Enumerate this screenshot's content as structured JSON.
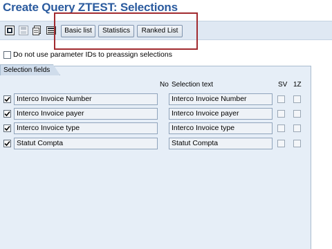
{
  "window": {
    "title": "Create Query ZTEST: Selections"
  },
  "toolbar": {
    "icons": [
      "execute-icon",
      "save-icon",
      "get-variant-icon",
      "display-list-icon"
    ],
    "buttons": {
      "basic_list": "Basic list",
      "statistics": "Statistics",
      "ranked_list": "Ranked List"
    }
  },
  "options": {
    "no_param_ids_label": "Do not use parameter IDs to preassign selections",
    "no_param_ids_checked": false
  },
  "selection_fields": {
    "tab_label": "Selection fields",
    "headers": {
      "no": "No",
      "selection_text": "Selection text",
      "sv": "SV",
      "z": "1Z"
    },
    "rows": [
      {
        "name": "Interco Invoice Number",
        "text": "Interco Invoice Number",
        "checked": true,
        "sv": false,
        "z": false
      },
      {
        "name": "Interco Invoice payer",
        "text": "Interco Invoice payer",
        "checked": true,
        "sv": false,
        "z": false
      },
      {
        "name": "Interco Invoice type",
        "text": "Interco Invoice type",
        "checked": true,
        "sv": false,
        "z": false
      },
      {
        "name": "Statut Compta",
        "text": "Statut Compta",
        "checked": true,
        "sv": false,
        "z": false
      }
    ]
  },
  "colors": {
    "title": "#2a5a9e",
    "highlight_box": "#a12a2f",
    "panel_bg": "#e6eef7"
  }
}
